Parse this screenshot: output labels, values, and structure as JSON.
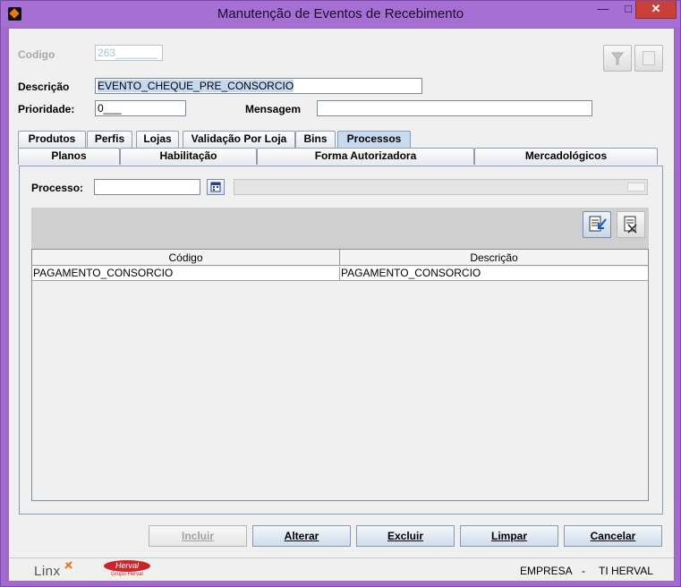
{
  "window": {
    "title": "Manutenção de Eventos de Recebimento",
    "minimize": "—",
    "maximize": "□",
    "close": "✕"
  },
  "form": {
    "codigo_label": "Codigo",
    "codigo_value": "263_______",
    "descricao_label": "Descrição",
    "descricao_value": "EVENTO_CHEQUE_PRE_CONSORCIO",
    "prioridade_label": "Prioridade:",
    "prioridade_value": "0___",
    "mensagem_label": "Mensagem",
    "mensagem_value": ""
  },
  "tabs_row1": [
    "Produtos",
    "Perfis",
    "Lojas",
    "Validação Por Loja",
    "Bins",
    "Processos"
  ],
  "tabs_row2": [
    "Planos",
    "Habilitação",
    "Forma Autorizadora",
    "Mercadológicos"
  ],
  "processo": {
    "label": "Processo:",
    "value": ""
  },
  "table": {
    "headers": [
      "Código",
      "Descrição"
    ],
    "rows": [
      [
        "PAGAMENTO_CONSORCIO",
        "PAGAMENTO_CONSORCIO"
      ]
    ]
  },
  "buttons": {
    "incluir": "Incluir",
    "alterar": "Alterar",
    "excluir": "Excluir",
    "limpar": "Limpar",
    "cancelar": "Cancelar"
  },
  "footer": {
    "linx": "Linx",
    "herval": "Herval",
    "herval_sub": "Grupo Herval",
    "empresa_label": "EMPRESA",
    "separator": "-",
    "empresa_value": "TI HERVAL"
  },
  "icons": [
    "app-icon",
    "filter-icon",
    "document-icon",
    "calendar-icon",
    "add-row-icon",
    "delete-row-icon"
  ],
  "colors": {
    "titlebar": "#a66fd4",
    "close": "#c7413a",
    "tab_active": "#c8daf0",
    "selection": "#c3d9ef"
  }
}
